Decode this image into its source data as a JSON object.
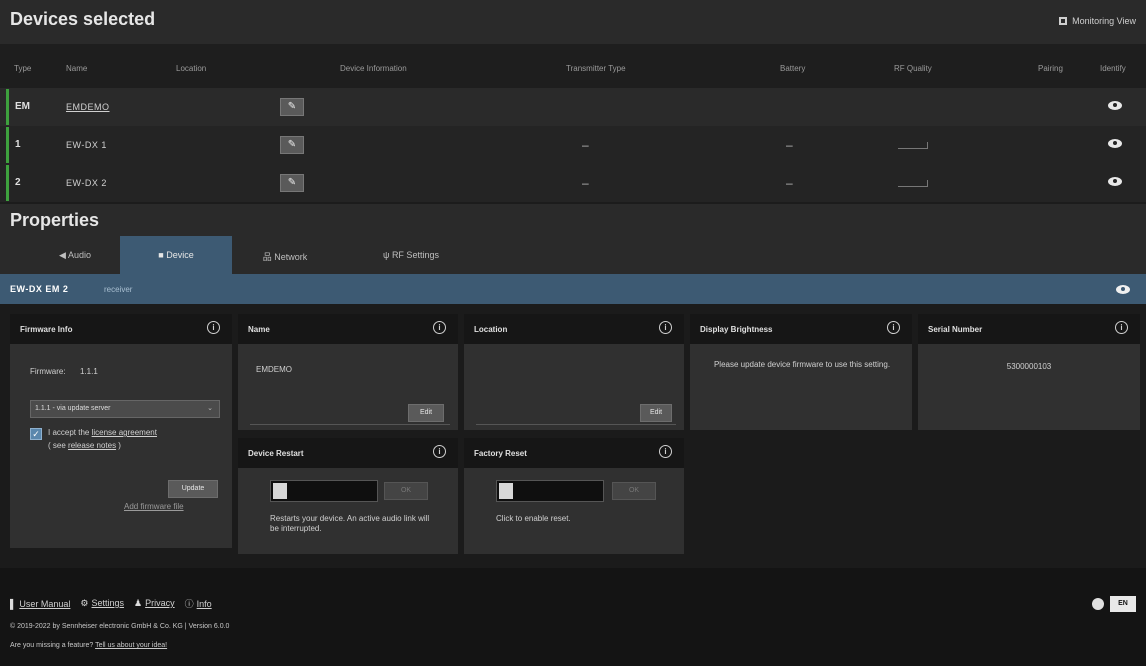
{
  "header": {
    "title": "Devices selected",
    "monitoring_view": "Monitoring View"
  },
  "columns": [
    "Type",
    "Name",
    "Location",
    "Device Information",
    "Transmitter Type",
    "Battery",
    "RF Quality",
    "Pairing",
    "Identify"
  ],
  "devices": [
    {
      "type": "EM",
      "name": "EMDEMO",
      "dash_tx": "",
      "dash_batt": ""
    },
    {
      "type": "1",
      "name": "EW-DX 1",
      "dash_tx": "–",
      "dash_batt": "–"
    },
    {
      "type": "2",
      "name": "EW-DX 2",
      "dash_tx": "–",
      "dash_batt": "–"
    }
  ],
  "properties": {
    "title": "Properties",
    "tabs": [
      "Audio",
      "Device",
      "Network",
      "RF Settings"
    ],
    "active_tab": "Device",
    "device_bar_title": "EW-DX EM 2",
    "device_bar_sub": "receiver"
  },
  "firmware": {
    "title": "Firmware Info",
    "label": "Firmware:",
    "version": "1.1.1",
    "select_value": "1.1.1 - via update server",
    "accept_text": "I accept the",
    "license": "license agreement",
    "see": "( see",
    "release_notes": "release notes",
    "see_end": ")",
    "update_btn": "Update",
    "add_file": "Add firmware file"
  },
  "name_card": {
    "title": "Name",
    "value": "EMDEMO",
    "edit": "Edit"
  },
  "location_card": {
    "title": "Location",
    "value": "",
    "edit": "Edit"
  },
  "brightness_card": {
    "title": "Display Brightness",
    "message": "Please update device firmware to use this setting."
  },
  "serial_card": {
    "title": "Serial Number",
    "value": "5300000103"
  },
  "restart_card": {
    "title": "Device Restart",
    "btn": "OK",
    "note": "Restarts your device. An active audio link will be interrupted."
  },
  "reset_card": {
    "title": "Factory Reset",
    "btn": "OK",
    "note": "Click to enable reset."
  },
  "footer": {
    "user_manual": "User Manual",
    "settings": "Settings",
    "privacy": "Privacy",
    "info": "Info",
    "copyright": "© 2019-2022 by Sennheiser electronic GmbH & Co. KG | Version 6.0.0",
    "feature_q": "Are you missing a feature?",
    "feature_link": "Tell us about your idea!",
    "lang": "EN"
  }
}
